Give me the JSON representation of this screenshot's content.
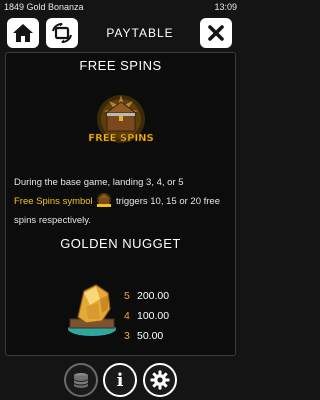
{
  "status_bar": {
    "app_title": "1849 Gold Bonanza",
    "clock": "13:09"
  },
  "header": {
    "title": "PAYTABLE",
    "home_icon": "home-icon",
    "rotate_icon": "screen-rotate-icon",
    "close_icon": "close-icon"
  },
  "free_spins": {
    "heading": "FREE SPINS",
    "symbol_text": "FREE SPINS",
    "description_1": "During the base game, landing 3, 4, or 5",
    "symbol_name": "Free Spins symbol",
    "description_2": "triggers 10, 15 or 20 free spins respectively."
  },
  "golden_nugget": {
    "heading": "GOLDEN NUGGET",
    "payouts": [
      {
        "count": "5",
        "amount": "200.00"
      },
      {
        "count": "4",
        "amount": "100.00"
      },
      {
        "count": "3",
        "amount": "50.00"
      }
    ]
  },
  "footer": {
    "coins_icon": "coin-stack-icon",
    "info_icon": "info-icon",
    "settings_icon": "gear-icon"
  },
  "colors": {
    "accent_gold": "#f2c21b",
    "count_orange": "#f2a82c",
    "background": "#141414"
  }
}
